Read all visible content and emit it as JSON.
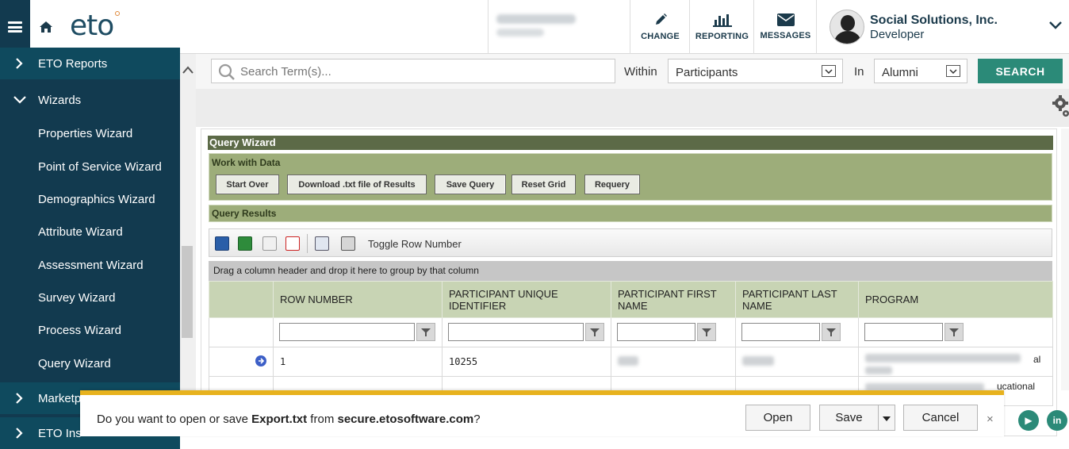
{
  "header": {
    "logo": "eto",
    "actions": [
      {
        "label": "CHANGE",
        "icon": "pencil-icon"
      },
      {
        "label": "REPORTING",
        "icon": "bar-chart-icon"
      },
      {
        "label": "MESSAGES",
        "icon": "envelope-icon"
      }
    ],
    "org_name": "Social Solutions, Inc.",
    "org_role": "Developer"
  },
  "sidebar": {
    "items": [
      {
        "label": "ETO Reports",
        "type": "top",
        "expanded": false
      },
      {
        "label": "Wizards",
        "type": "top",
        "expanded": true
      },
      {
        "label": "Properties Wizard",
        "type": "sub"
      },
      {
        "label": "Point of Service Wizard",
        "type": "sub"
      },
      {
        "label": "Demographics Wizard",
        "type": "sub"
      },
      {
        "label": "Attribute Wizard",
        "type": "sub"
      },
      {
        "label": "Assessment Wizard",
        "type": "sub"
      },
      {
        "label": "Survey Wizard",
        "type": "sub"
      },
      {
        "label": "Process Wizard",
        "type": "sub"
      },
      {
        "label": "Query Wizard",
        "type": "sub"
      },
      {
        "label": "Marketp",
        "type": "top",
        "expanded": false
      },
      {
        "label": "ETO Ins",
        "type": "top",
        "expanded": false
      }
    ]
  },
  "search": {
    "placeholder": "Search Term(s)...",
    "within_label": "Within",
    "within_value": "Participants",
    "in_label": "In",
    "in_value": "Alumni",
    "button": "SEARCH"
  },
  "query_wizard": {
    "title": "Query Wizard",
    "work_with_data": "Work with Data",
    "buttons": [
      "Start Over",
      "Download .txt file of Results",
      "Save Query",
      "Reset Grid",
      "Requery"
    ],
    "results_title": "Query Results",
    "toggle_row_number": "Toggle Row Number",
    "group_hint": "Drag a column header and drop it here to group by that column",
    "columns": [
      "ROW NUMBER",
      "PARTICIPANT UNIQUE IDENTIFIER",
      "PARTICIPANT FIRST NAME",
      "PARTICIPANT LAST NAME",
      "PROGRAM"
    ],
    "rows": [
      {
        "row_number": "1",
        "uid": "10255",
        "program_suffix": "al"
      },
      {
        "program_suffix": "ucational"
      }
    ]
  },
  "download_bar": {
    "prefix": "Do you want to open or save ",
    "file": "Export.txt",
    "middle": " from ",
    "site": "secure.etosoftware.com",
    "suffix": "?",
    "open": "Open",
    "save": "Save",
    "cancel": "Cancel",
    "close": "×"
  },
  "colors": {
    "sidebar": "#123a4f",
    "accent": "#2b8a78",
    "grid_header": "#c8d4b4",
    "panel_green": "#9dad7a",
    "title_green": "#5c6a47",
    "download_border": "#e7b21e"
  }
}
